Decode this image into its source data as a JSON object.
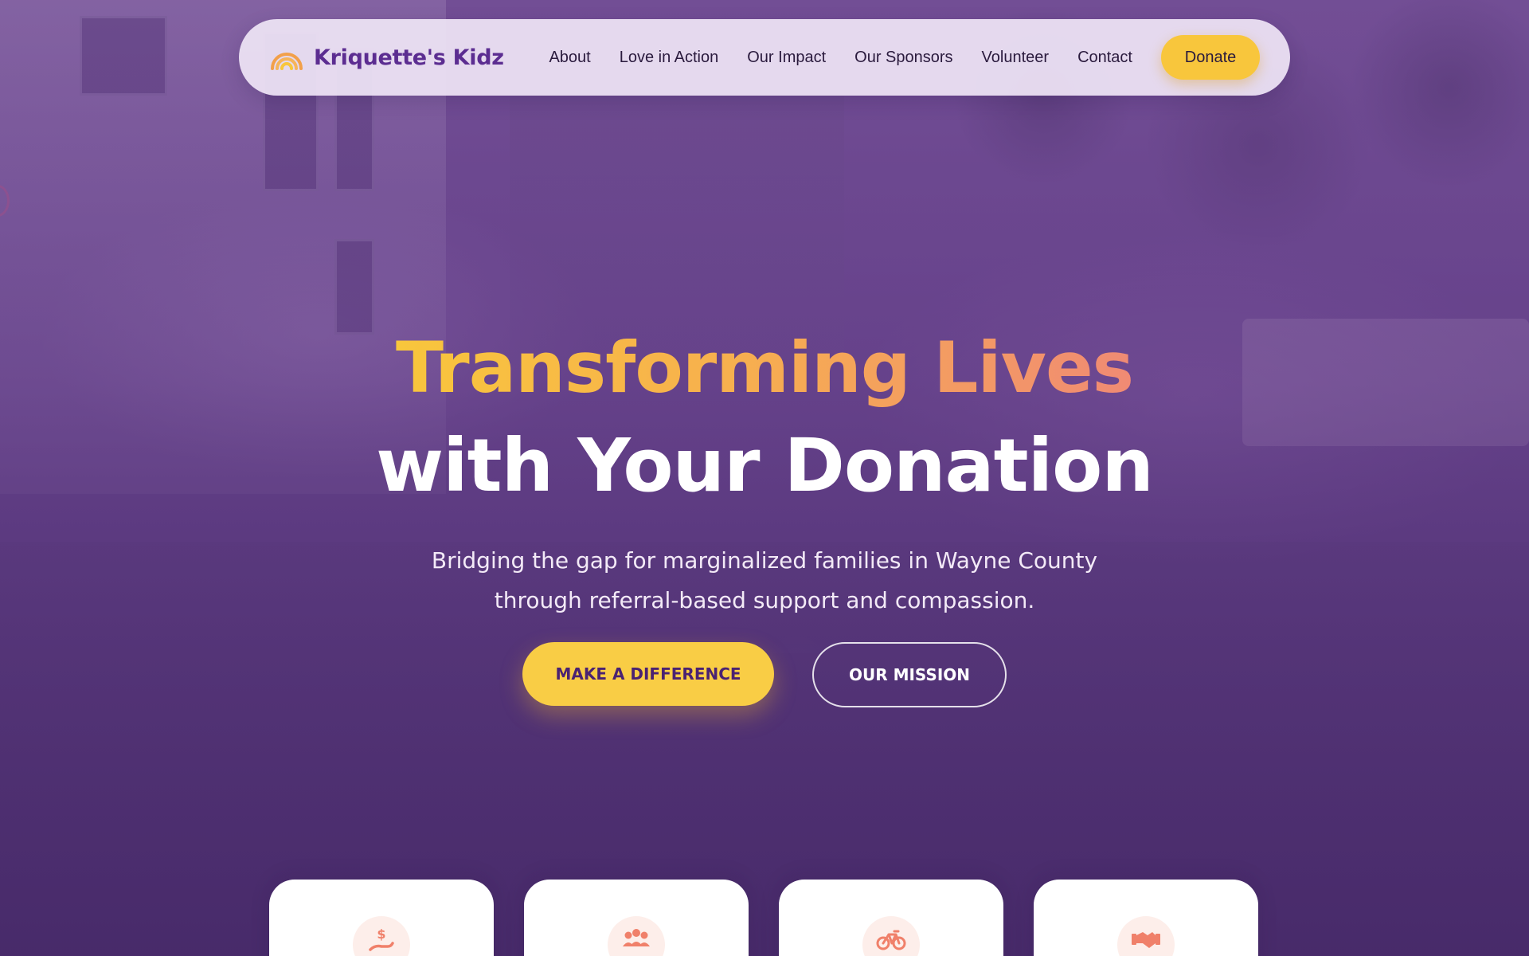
{
  "brand": {
    "name": "Kriquette's Kidz",
    "logo_icon": "rainbow-icon",
    "primary_color": "#5c2d91",
    "accent_color": "#f8c63c"
  },
  "nav": {
    "links": [
      "About",
      "Love in Action",
      "Our Impact",
      "Our Sponsors",
      "Volunteer",
      "Contact"
    ],
    "donate_label": "Donate"
  },
  "hero": {
    "headline_line1": "Transforming Lives",
    "headline_line2": "with Your Donation",
    "subheading": "Bridging the gap for marginalized families in Wayne County through referral-based support and compassion.",
    "cta_primary": "MAKE A DIFFERENCE",
    "cta_secondary": "OUR MISSION"
  },
  "cards": [
    {
      "icon": "donation-hand-icon"
    },
    {
      "icon": "people-group-icon"
    },
    {
      "icon": "bicycle-icon"
    },
    {
      "icon": "handshake-icon"
    }
  ]
}
